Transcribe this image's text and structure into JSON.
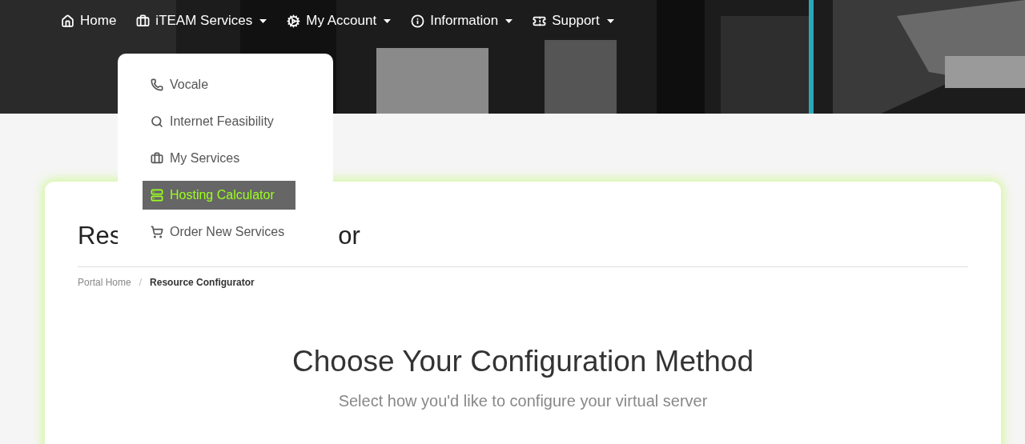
{
  "nav": [
    {
      "label": "Home",
      "dropdown": false
    },
    {
      "label": "iTEAM Services",
      "dropdown": true
    },
    {
      "label": "My Account",
      "dropdown": true
    },
    {
      "label": "Information",
      "dropdown": true
    },
    {
      "label": "Support",
      "dropdown": true
    }
  ],
  "menu": [
    {
      "label": "Vocale",
      "selected": false
    },
    {
      "label": "Internet Feasibility",
      "selected": false
    },
    {
      "label": "My Services",
      "selected": false
    },
    {
      "label": "Hosting Calculator",
      "selected": true
    },
    {
      "label": "Order New Services",
      "selected": false
    }
  ],
  "page_title_visible_parts": [
    "Res",
    "or"
  ],
  "breadcrumb": [
    {
      "label": "Portal Home",
      "current": false
    },
    {
      "separator": "/",
      "label": "Resource Configurator",
      "current": true
    }
  ],
  "heading": "Choose Your Configuration Method",
  "subheading": "Select how you'd like to configure your virtual server"
}
